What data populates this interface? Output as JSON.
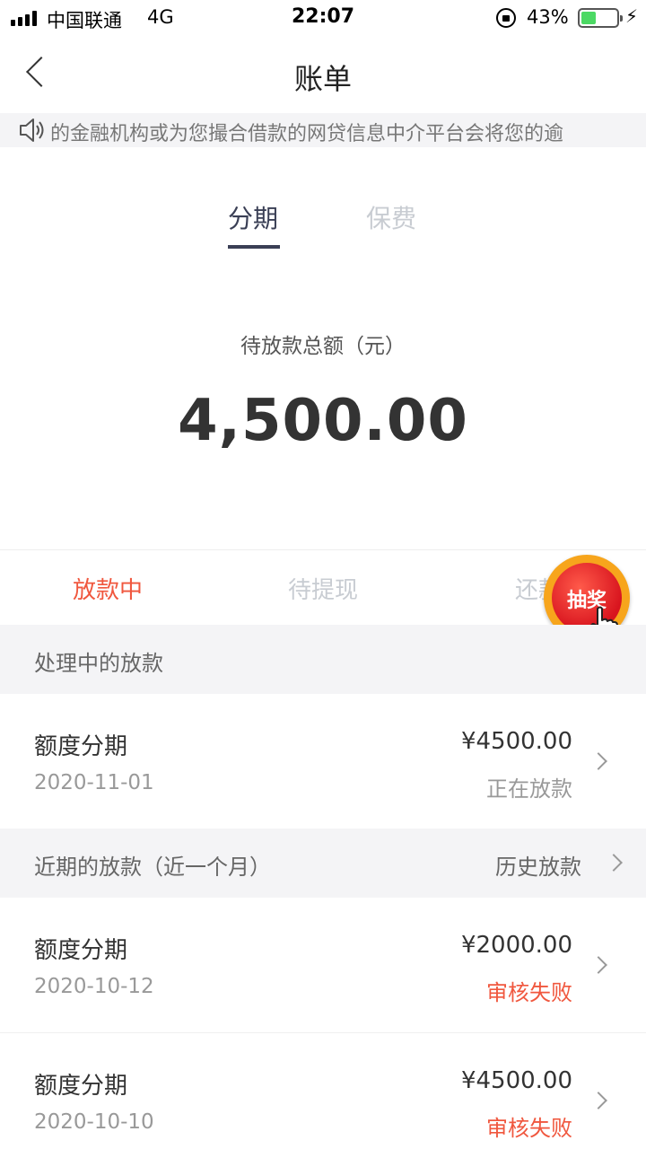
{
  "status_bar": {
    "carrier": "中国联通",
    "network": "4G",
    "time": "22:07",
    "battery_pct": "43%",
    "battery_level": 0.43
  },
  "nav": {
    "title": "账单"
  },
  "notice": {
    "text": "的金融机构或为您撮合借款的网贷信息中介平台会将您的逾"
  },
  "top_tabs": [
    {
      "label": "分期",
      "active": true
    },
    {
      "label": "保费",
      "active": false
    }
  ],
  "summary": {
    "label": "待放款总额（元）",
    "amount": "4,500.00"
  },
  "status_tabs": [
    {
      "label": "放款中",
      "active": true
    },
    {
      "label": "待提现",
      "active": false
    },
    {
      "label": "还款",
      "active": false
    }
  ],
  "lottery": {
    "label": "抽奖"
  },
  "processing_section": {
    "title": "处理中的放款",
    "items": [
      {
        "name": "额度分期",
        "date": "2020-11-01",
        "amount": "¥4500.00",
        "status": "正在放款"
      }
    ]
  },
  "recent_section": {
    "title": "近期的放款（近一个月）",
    "history_link": "历史放款",
    "items": [
      {
        "name": "额度分期",
        "date": "2020-10-12",
        "amount": "¥2000.00",
        "status": "审核失败"
      },
      {
        "name": "额度分期",
        "date": "2020-10-10",
        "amount": "¥4500.00",
        "status": "审核失败"
      }
    ]
  },
  "colors": {
    "accent_red": "#f0573e",
    "tab_active": "#3a3f55",
    "muted": "#999999"
  }
}
